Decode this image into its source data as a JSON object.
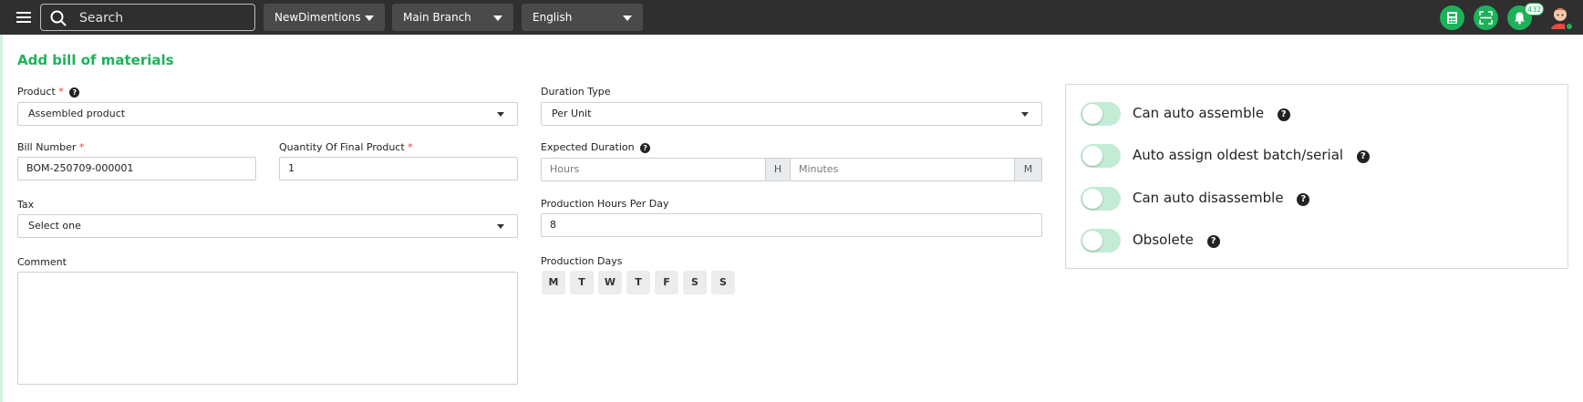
{
  "topbar": {
    "search_placeholder": "Search",
    "company": "NewDimentions",
    "branch": "Main Branch",
    "language": "English",
    "notification_count": "432",
    "accent_color": "#1db25a"
  },
  "page": {
    "title": "Add bill of materials"
  },
  "form": {
    "product": {
      "label": "Product",
      "required": "*",
      "value": "Assembled product"
    },
    "bill_number": {
      "label": "Bill Number",
      "required": "*",
      "value": "BOM-250709-000001"
    },
    "quantity": {
      "label": "Quantity Of Final Product",
      "required": "*",
      "value": "1"
    },
    "tax": {
      "label": "Tax",
      "value": "Select one"
    },
    "comment": {
      "label": "Comment",
      "value": ""
    },
    "duration_type": {
      "label": "Duration Type",
      "value": "Per Unit"
    },
    "expected_duration": {
      "label": "Expected Duration",
      "hours_placeholder": "Hours",
      "hours_addon": "H",
      "minutes_placeholder": "Minutes",
      "minutes_addon": "M"
    },
    "production_hours": {
      "label": "Production Hours Per Day",
      "value": "8"
    },
    "production_days": {
      "label": "Production Days",
      "days": [
        "M",
        "T",
        "W",
        "T",
        "F",
        "S",
        "S"
      ]
    }
  },
  "options": {
    "can_auto_assemble": {
      "label": "Can auto assemble",
      "enabled": false
    },
    "auto_assign_oldest": {
      "label": "Auto assign oldest batch/serial",
      "enabled": false
    },
    "can_auto_disassemble": {
      "label": "Can auto disassemble",
      "enabled": false
    },
    "obsolete": {
      "label": "Obsolete",
      "enabled": false
    }
  },
  "icons": {
    "menu": "hamburger-icon",
    "search": "search-icon",
    "calculator": "calculator-icon",
    "scan": "scan-icon",
    "notifications": "bell-icon",
    "help": "question-circle-icon"
  }
}
